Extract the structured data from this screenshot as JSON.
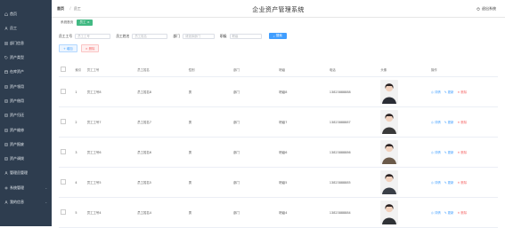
{
  "sidebar": {
    "items": [
      {
        "label": "首页",
        "icon": "home-icon",
        "chevron": ""
      },
      {
        "label": "员工",
        "icon": "user-icon",
        "chevron": ""
      },
      {
        "label": "部门信息",
        "icon": "grid-icon",
        "chevron": ""
      },
      {
        "label": "资产类型",
        "icon": "tag-icon",
        "chevron": ""
      },
      {
        "label": "在库资产",
        "icon": "box-icon",
        "chevron": ""
      },
      {
        "label": "资产领用",
        "icon": "doc-icon",
        "chevron": ""
      },
      {
        "label": "资产借用",
        "icon": "doc-icon",
        "chevron": ""
      },
      {
        "label": "资产归还",
        "icon": "doc-icon",
        "chevron": ""
      },
      {
        "label": "资产维修",
        "icon": "doc-icon",
        "chevron": ""
      },
      {
        "label": "资产报废",
        "icon": "doc-icon",
        "chevron": ""
      },
      {
        "label": "资产调拨",
        "icon": "doc-icon",
        "chevron": ""
      },
      {
        "label": "管理员管理",
        "icon": "user-icon",
        "chevron": ""
      },
      {
        "label": "系统管理",
        "icon": "gear-icon",
        "chevron": "⌄"
      },
      {
        "label": "我的信息",
        "icon": "user-icon",
        "chevron": "⌄"
      }
    ]
  },
  "header": {
    "breadcrumb_home": "首页",
    "breadcrumb_current": "员工",
    "title": "企业资产管理系统",
    "logout": "退出系统"
  },
  "tabs": [
    {
      "label": "系统首页",
      "active": false
    },
    {
      "label": "员工 ×",
      "active": true
    }
  ],
  "filters": [
    {
      "label": "员工工号",
      "placeholder": "员工工号"
    },
    {
      "label": "员工姓名",
      "placeholder": "员工姓名"
    },
    {
      "label": "部门",
      "placeholder": "请选择部门"
    },
    {
      "label": "职级",
      "placeholder": "职级"
    }
  ],
  "search_label": "搜索",
  "add_label": "增加",
  "delete_label": "删除",
  "table": {
    "headers": [
      "",
      "索引",
      "员工工号",
      "员工姓名",
      "性别",
      "部门",
      "职级",
      "电话",
      "头像",
      "操作"
    ],
    "rows": [
      {
        "idx": "1",
        "no": "员工工号8",
        "name": "员工姓名8",
        "sex": "男",
        "dept": "部门",
        "rank": "职级8",
        "phone": "13823888888",
        "av": "#2a2d35"
      },
      {
        "idx": "2",
        "no": "员工工号7",
        "name": "员工姓名7",
        "sex": "男",
        "dept": "部门",
        "rank": "职级7",
        "phone": "13823888887",
        "av": "#3a3a3a"
      },
      {
        "idx": "3",
        "no": "员工工号6",
        "name": "员工姓名6",
        "sex": "男",
        "dept": "部门",
        "rank": "职级6",
        "phone": "13823888886",
        "av": "#6b5a4a"
      },
      {
        "idx": "4",
        "no": "员工工号5",
        "name": "员工姓名5",
        "sex": "男",
        "dept": "部门",
        "rank": "职级5",
        "phone": "13823888885",
        "av": "#3a3f47"
      },
      {
        "idx": "5",
        "no": "员工工号4",
        "name": "员工姓名4",
        "sex": "男",
        "dept": "部门",
        "rank": "职级4",
        "phone": "13823888884",
        "av": "#2f3236"
      }
    ],
    "ops": {
      "detail": "详情",
      "edit": "更新",
      "delete": "删除"
    }
  }
}
